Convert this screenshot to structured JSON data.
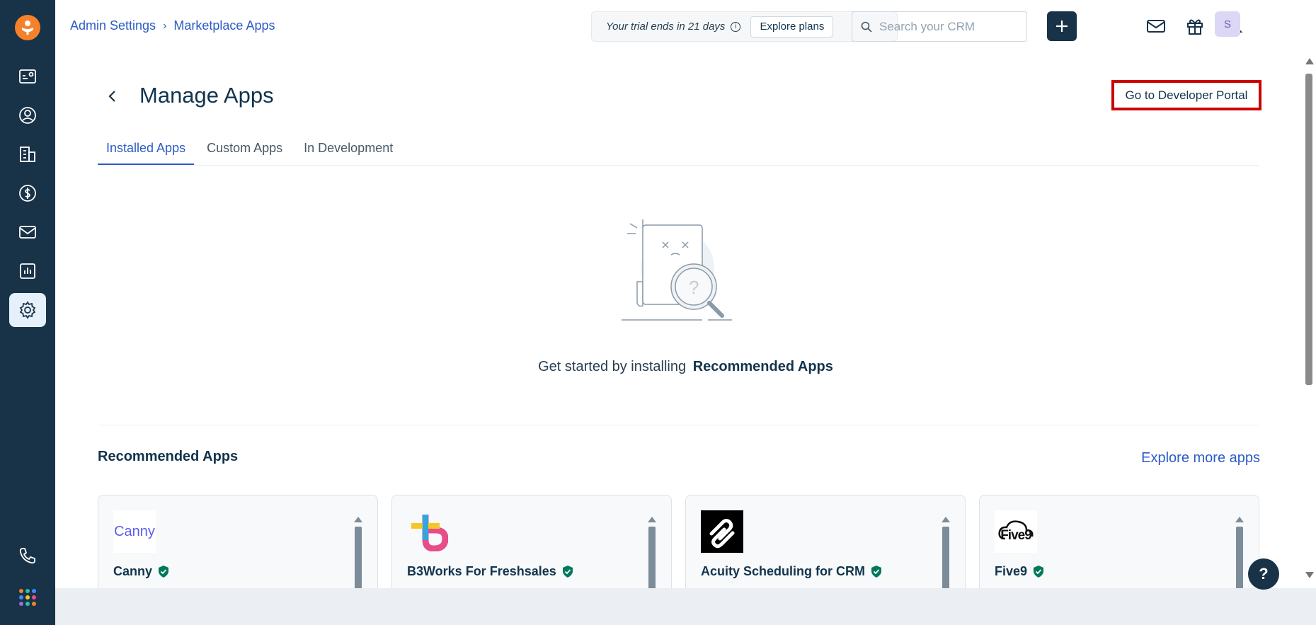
{
  "breadcrumb": {
    "parent": "Admin Settings",
    "current": "Marketplace Apps"
  },
  "trial": {
    "text": "Your trial ends in 21 days",
    "cta": "Explore plans"
  },
  "search": {
    "placeholder": "Search your CRM"
  },
  "user": {
    "initial": "S"
  },
  "page": {
    "title": "Manage Apps",
    "developer_portal_button": "Go to Developer Portal",
    "tabs": [
      {
        "label": "Installed Apps",
        "active": true
      },
      {
        "label": "Custom Apps",
        "active": false
      },
      {
        "label": "In Development",
        "active": false
      }
    ],
    "empty_state": {
      "text": "Get started by installing",
      "highlight": "Recommended Apps"
    }
  },
  "recommended": {
    "title": "Recommended Apps",
    "explore_more": "Explore more apps",
    "apps": [
      {
        "name": "Canny",
        "logo_text": "Canny",
        "verified": true
      },
      {
        "name": "B3Works For Freshsales",
        "verified": true
      },
      {
        "name": "Acuity Scheduling for CRM",
        "verified": true
      },
      {
        "name": "Five9",
        "logo_text": "Five9",
        "verified": true
      }
    ]
  },
  "help": {
    "label": "?"
  },
  "colors": {
    "rail": "#183247",
    "accent": "#2c5cc5",
    "highlight_border": "#cc0000",
    "logo": "#f5822a"
  }
}
